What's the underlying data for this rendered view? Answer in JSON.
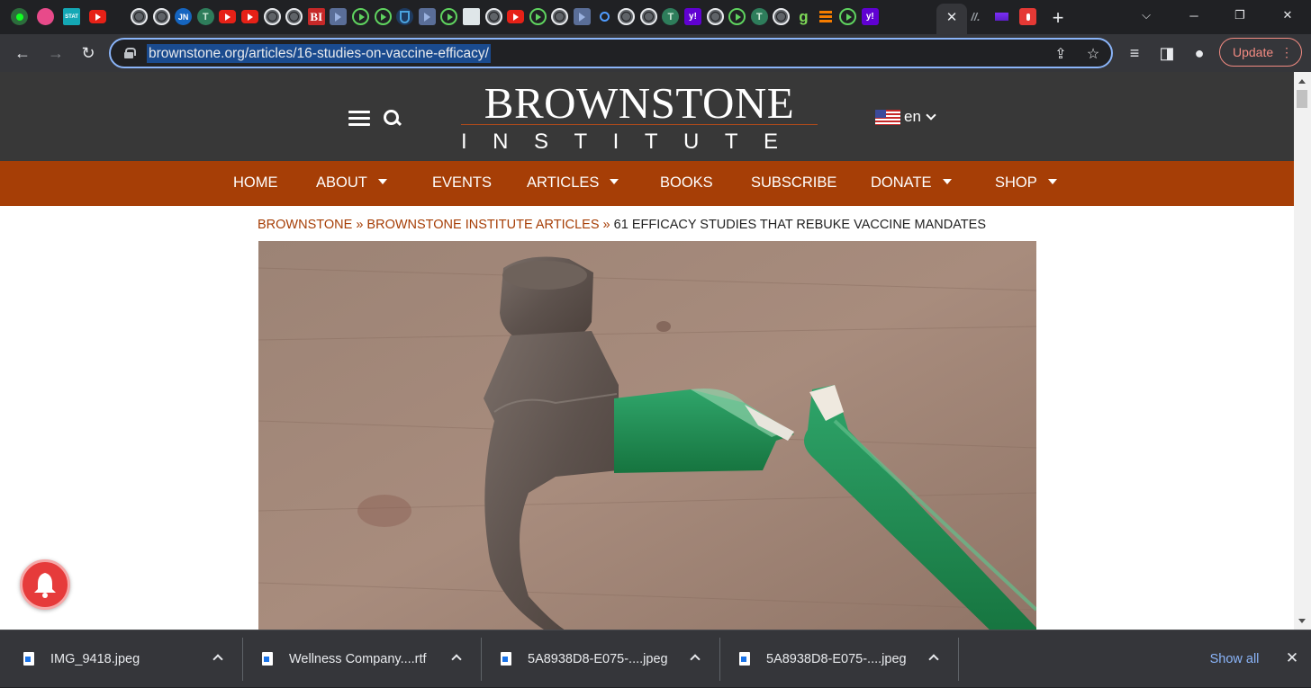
{
  "browser": {
    "tab_favicons": [
      {
        "icon": "globe-tree-icon",
        "text": ""
      },
      {
        "icon": "pink-flower-icon",
        "text": ""
      },
      {
        "icon": "stat-news-icon",
        "text": "STAT"
      },
      {
        "icon": "youtube-icon",
        "text": ""
      },
      {
        "icon": "globe-icon",
        "text": ""
      },
      {
        "icon": "globe-icon",
        "text": ""
      },
      {
        "icon": "jn-icon",
        "text": "JN"
      },
      {
        "icon": "tree-icon",
        "text": ""
      },
      {
        "icon": "youtube-icon",
        "text": ""
      },
      {
        "icon": "youtube-icon",
        "text": ""
      },
      {
        "icon": "globe-icon",
        "text": ""
      },
      {
        "icon": "globe-icon",
        "text": ""
      },
      {
        "icon": "business-insider-icon",
        "text": "BI"
      },
      {
        "icon": "flag-icon",
        "text": ""
      },
      {
        "icon": "play-icon",
        "text": ""
      },
      {
        "icon": "play-icon",
        "text": ""
      },
      {
        "icon": "shield-icon",
        "text": ""
      },
      {
        "icon": "flag-icon",
        "text": ""
      },
      {
        "icon": "play-icon",
        "text": ""
      },
      {
        "icon": "grid-icon",
        "text": ""
      },
      {
        "icon": "globe-icon",
        "text": ""
      },
      {
        "icon": "youtube-icon",
        "text": ""
      },
      {
        "icon": "play-icon",
        "text": ""
      },
      {
        "icon": "globe-icon",
        "text": ""
      },
      {
        "icon": "flag-icon",
        "text": ""
      },
      {
        "icon": "search-icon",
        "text": ""
      },
      {
        "icon": "globe-icon",
        "text": ""
      },
      {
        "icon": "globe-icon",
        "text": ""
      },
      {
        "icon": "tree-icon",
        "text": ""
      },
      {
        "icon": "yahoo-icon",
        "text": "y!"
      },
      {
        "icon": "globe-icon",
        "text": ""
      },
      {
        "icon": "play-icon",
        "text": ""
      },
      {
        "icon": "tree-icon",
        "text": ""
      },
      {
        "icon": "globe-icon",
        "text": ""
      },
      {
        "icon": "g-icon",
        "text": "g"
      },
      {
        "icon": "orange-bars-icon",
        "text": ""
      },
      {
        "icon": "play-icon",
        "text": ""
      },
      {
        "icon": "yahoo-icon",
        "text": "y!"
      }
    ],
    "tab_favicons_after_active": [
      {
        "icon": "stripes-icon",
        "text": "//."
      },
      {
        "icon": "purple-envelope-icon",
        "text": ""
      },
      {
        "icon": "microphone-icon",
        "text": ""
      }
    ],
    "url": "brownstone.org/articles/16-studies-on-vaccine-efficacy/",
    "update_label": "Update",
    "accent_color": "#8ab4f8",
    "update_color": "#f28b82"
  },
  "site": {
    "logo_top": "BROWNSTONE",
    "logo_bottom": "INSTITUTE",
    "language": "en",
    "brand_color": "#a63e06",
    "header_color": "#383838",
    "nav": [
      {
        "label": "HOME",
        "dropdown": false
      },
      {
        "label": "ABOUT",
        "dropdown": true
      },
      {
        "label": "EVENTS",
        "dropdown": false
      },
      {
        "label": "ARTICLES",
        "dropdown": true
      },
      {
        "label": "BOOKS",
        "dropdown": false
      },
      {
        "label": "SUBSCRIBE",
        "dropdown": false
      },
      {
        "label": "DONATE",
        "dropdown": true
      },
      {
        "label": "SHOP",
        "dropdown": true
      }
    ],
    "breadcrumb": {
      "home": "BROWNSTONE",
      "separator": "»",
      "section": "BROWNSTONE INSTITUTE ARTICLES",
      "current": "61 EFFICACY STUDIES THAT REBUKE VACCINE MANDATES"
    },
    "hero_image": "broken-hammer-photo"
  },
  "downloads": {
    "items": [
      {
        "name": "IMG_9418.jpeg",
        "icon": "image-file-icon"
      },
      {
        "name": "Wellness Company....rtf",
        "icon": "word-file-icon"
      },
      {
        "name": "5A8938D8-E075-....jpeg",
        "icon": "image-file-icon"
      },
      {
        "name": "5A8938D8-E075-....jpeg",
        "icon": "image-file-icon"
      }
    ],
    "show_all_label": "Show all"
  }
}
